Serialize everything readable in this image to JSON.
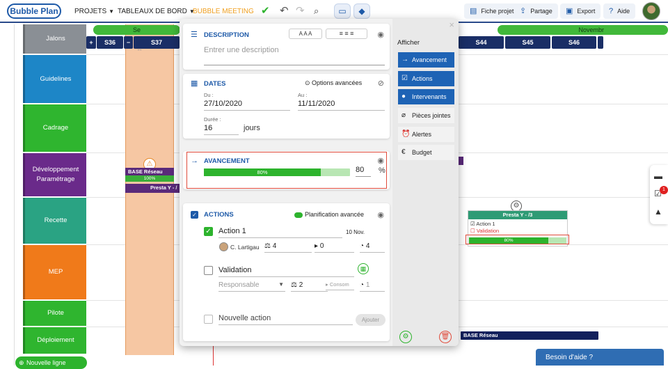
{
  "topbar": {
    "logo": "Bubble Plan",
    "nav": [
      {
        "label": "PROJETS"
      },
      {
        "label": "TABLEAUX DE BORD"
      },
      {
        "label": "BUBBLE MEETING"
      }
    ],
    "right_buttons": [
      {
        "label": "Fiche projet",
        "icon": "book-icon"
      },
      {
        "label": "Partage",
        "icon": "share-icon"
      },
      {
        "label": "Export",
        "icon": "export-icon"
      },
      {
        "label": "Aide",
        "icon": "help-icon"
      }
    ]
  },
  "gantt": {
    "lanes": [
      {
        "label": "Jalons",
        "color": "#8a8f95"
      },
      {
        "label": "Guidelines",
        "color": "#1d86c7"
      },
      {
        "label": "Cadrage",
        "color": "#2fb52f"
      },
      {
        "label": "Développement Paramétrage",
        "color": "#6a2a8a"
      },
      {
        "label": "Recette",
        "color": "#2aa383"
      },
      {
        "label": "MEP",
        "color": "#f07a1a"
      },
      {
        "label": "Pilote",
        "color": "#2fb52f"
      },
      {
        "label": "Déploiement",
        "color": "#2fb52f"
      }
    ],
    "weeks": [
      "S36",
      "S37",
      "S44",
      "S45",
      "S46"
    ],
    "month_left": "Se",
    "month_right": "Novembr",
    "tasks": {
      "base_reseau": "BASE Réseau",
      "base_percent": "100%",
      "presta_left": "Presta Y - /",
      "card_title": "Presta Y - /3",
      "card_action1": "Action 1",
      "card_action2": "Validation",
      "card_progress": "80%",
      "base_reseau_2": "BASE Réseau"
    },
    "new_line": "Nouvelle ligne"
  },
  "modal": {
    "description": {
      "title": "DESCRIPTION",
      "placeholder": "Entrer une description"
    },
    "dates": {
      "title": "DATES",
      "advanced": "Options avancées",
      "from_label": "Du :",
      "from_value": "27/10/2020",
      "to_label": "Au :",
      "to_value": "11/11/2020",
      "duration_label": "Durée :",
      "duration_value": "16",
      "duration_unit": "jours"
    },
    "progress": {
      "title": "AVANCEMENT",
      "bar_label": "80%",
      "percent": 80,
      "value": "80",
      "unit": "%"
    },
    "actions": {
      "title": "ACTIONS",
      "advanced": "Planification avancée",
      "items": [
        {
          "name": "Action 1",
          "date": "10 Nov.",
          "assignee": "C. Lartigau",
          "load": "4",
          "consumed": "0",
          "remaining": "4",
          "done": true
        },
        {
          "name": "Validation",
          "assignee_placeholder": "Responsable",
          "load": "2",
          "consumed_placeholder": "Consom",
          "remaining": "1",
          "done": false
        }
      ],
      "new_placeholder": "Nouvelle action",
      "add_button": "Ajouter"
    },
    "side": {
      "title": "Afficher",
      "items": [
        {
          "label": "Avancement",
          "active": true
        },
        {
          "label": "Actions",
          "active": true
        },
        {
          "label": "Intervenants",
          "active": true
        },
        {
          "label": "Pièces jointes",
          "active": false
        },
        {
          "label": "Alertes",
          "active": false
        },
        {
          "label": "Budget",
          "active": false
        }
      ]
    }
  },
  "help": "Besoin d'aide ?",
  "notifications_count": "1",
  "colors": {
    "accent": "#1e5aa8",
    "green": "#2db32d",
    "highlight": "#e04a3a"
  }
}
